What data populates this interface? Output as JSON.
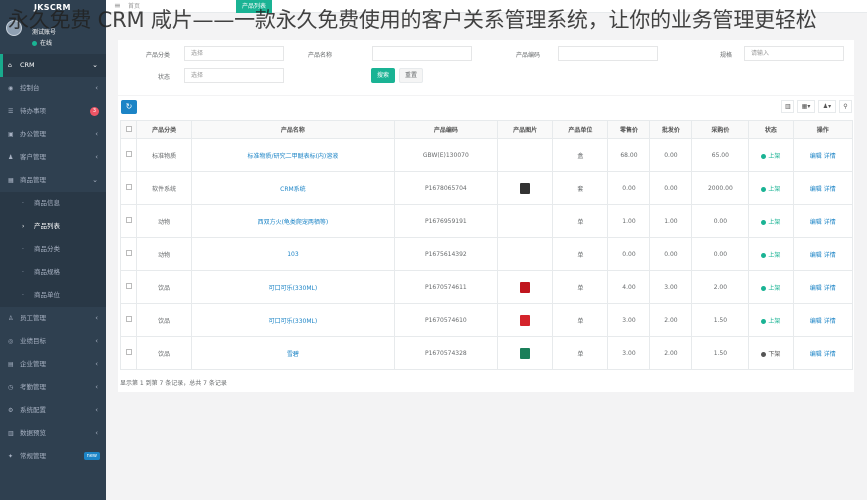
{
  "overlay_title": "永久免费 CRM 咸片——一款永久免费使用的客户关系管理系统，让你的业务管理更轻松",
  "brand": "JKSCRM",
  "user": {
    "name": "测试账号",
    "status": "在线"
  },
  "topbar": {
    "menu_icon": "≡",
    "home_tab": "首页",
    "active_tab": "产品列表"
  },
  "sidebar": {
    "items": [
      {
        "label": "CRM",
        "icon": "home-icon",
        "glyph": "⌂",
        "active": true
      },
      {
        "label": "控制台",
        "icon": "dashboard-icon",
        "glyph": "◉"
      },
      {
        "label": "待办事项",
        "icon": "todo-icon",
        "glyph": "☰",
        "badge": "3"
      },
      {
        "label": "办公管理",
        "icon": "office-icon",
        "glyph": "▣"
      },
      {
        "label": "客户管理",
        "icon": "customer-icon",
        "glyph": "♟"
      },
      {
        "label": "商品管理",
        "icon": "product-icon",
        "glyph": "▦",
        "open": true
      },
      {
        "label": "商品信息",
        "sub": true
      },
      {
        "label": "产品列表",
        "sub": true,
        "current": true
      },
      {
        "label": "商品分类",
        "sub": true
      },
      {
        "label": "商品规格",
        "sub": true
      },
      {
        "label": "商品单位",
        "sub": true
      },
      {
        "label": "员工管理",
        "icon": "staff-icon",
        "glyph": "♙"
      },
      {
        "label": "业绩目标",
        "icon": "target-icon",
        "glyph": "◎"
      },
      {
        "label": "企业管理",
        "icon": "company-icon",
        "glyph": "▤"
      },
      {
        "label": "考勤管理",
        "icon": "attendance-icon",
        "glyph": "◷"
      },
      {
        "label": "系统配置",
        "icon": "settings-icon",
        "glyph": "⚙"
      },
      {
        "label": "数据预览",
        "icon": "data-icon",
        "glyph": "▥"
      },
      {
        "label": "常规管理",
        "icon": "general-icon",
        "glyph": "✦",
        "badge_new": "new"
      }
    ]
  },
  "filter": {
    "category_label": "产品分类",
    "category_value": "选择",
    "name_label": "产品名称",
    "name_placeholder": "",
    "code_label": "产品编码",
    "code_placeholder": "",
    "spec_label": "规格",
    "spec_value": "请输入",
    "status_label": "状态",
    "status_value": "选择",
    "search_btn": "搜索",
    "reset_btn": "重置"
  },
  "toolbar": {
    "refresh_icon": "↻",
    "tools": [
      "▥",
      "▦▾",
      "♟▾",
      "⚲"
    ]
  },
  "table": {
    "headers": [
      "产品分类",
      "产品名称",
      "产品编码",
      "产品图片",
      "产品单位",
      "零售价",
      "批发价",
      "采购价",
      "状态",
      "操作"
    ],
    "rows": [
      {
        "category": "标准物质",
        "name": "标准物质/研究二甲醚表标(内)溶液",
        "code": "GBW(E)130070",
        "img": "",
        "unit": "盒",
        "retail": "68.00",
        "wholesale": "0.00",
        "purchase": "65.00",
        "status": "上架",
        "on": true,
        "ops": "编辑 详情"
      },
      {
        "category": "软件系统",
        "name": "CRM系统",
        "code": "P1678065704",
        "img": "#333",
        "unit": "套",
        "retail": "0.00",
        "wholesale": "0.00",
        "purchase": "2000.00",
        "status": "上架",
        "on": true,
        "ops": "编辑 详情"
      },
      {
        "category": "动物",
        "name": "西双方火(龟类爬宠两栖等)",
        "code": "P1676959191",
        "img": "",
        "unit": "单",
        "retail": "1.00",
        "wholesale": "1.00",
        "purchase": "0.00",
        "status": "上架",
        "on": true,
        "ops": "编辑 详情"
      },
      {
        "category": "动物",
        "name": "103",
        "code": "P1675614392",
        "img": "",
        "unit": "单",
        "retail": "0.00",
        "wholesale": "0.00",
        "purchase": "0.00",
        "status": "上架",
        "on": true,
        "ops": "编辑 详情"
      },
      {
        "category": "饮品",
        "name": "可口可乐(330ML)",
        "code": "P1670574611",
        "img": "#c0161e",
        "unit": "单",
        "retail": "4.00",
        "wholesale": "3.00",
        "purchase": "2.00",
        "status": "上架",
        "on": true,
        "ops": "编辑 详情"
      },
      {
        "category": "饮品",
        "name": "可口可乐(330ML)",
        "code": "P1670574610",
        "img": "#d4232b",
        "unit": "单",
        "retail": "3.00",
        "wholesale": "2.00",
        "purchase": "1.50",
        "status": "上架",
        "on": true,
        "ops": "编辑 详情"
      },
      {
        "category": "饮品",
        "name": "雪碧",
        "code": "P1670574328",
        "img": "#1a7f5a",
        "unit": "单",
        "retail": "3.00",
        "wholesale": "2.00",
        "purchase": "1.50",
        "status": "下架",
        "on": false,
        "ops": "编辑 详情"
      }
    ]
  },
  "pager": "显示第 1 到第 7 条记录，总共 7 条记录"
}
